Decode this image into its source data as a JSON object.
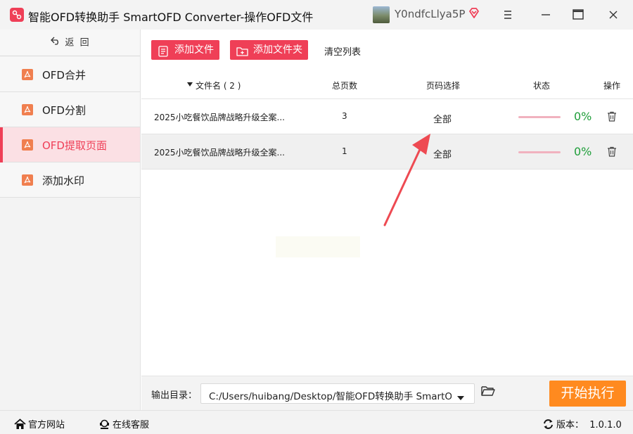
{
  "window": {
    "title": "智能OFD转换助手 SmartOFD Converter-操作OFD文件",
    "username": "Y0ndfcLlya5P",
    "accent": "#ef3f57"
  },
  "sidebar": {
    "back_label": "返  回",
    "items": [
      {
        "label": "OFD合并",
        "icon": "pdf-icon"
      },
      {
        "label": "OFD分割",
        "icon": "pdf-icon"
      },
      {
        "label": "OFD提取页面",
        "icon": "pdf-icon",
        "active": true
      },
      {
        "label": "添加水印",
        "icon": "pdf-icon"
      }
    ]
  },
  "toolbar": {
    "add_file": "添加文件",
    "add_folder": "添加文件夹",
    "clear_list": "清空列表"
  },
  "table": {
    "columns": {
      "filename": "文件名 ( 2 )",
      "total_pages": "总页数",
      "page_select": "页码选择",
      "status": "状态",
      "action": "操作"
    },
    "rows": [
      {
        "filename": "2025小吃餐饮品牌战略升级全案...",
        "pages": "3",
        "page_select": "全部",
        "progress": "0%"
      },
      {
        "filename": "2025小吃餐饮品牌战略升级全案...",
        "pages": "1",
        "page_select": "全部",
        "progress": "0%"
      }
    ]
  },
  "output": {
    "label": "输出目录：",
    "path": "C:/Users/huibang/Desktop/智能OFD转换助手 SmartOFD Converter",
    "start_label": "开始执行",
    "start_color": "#ff8a1f"
  },
  "statusbar": {
    "website": "官方网站",
    "support": "在线客服",
    "version": "版本：  1.0.1.0"
  }
}
